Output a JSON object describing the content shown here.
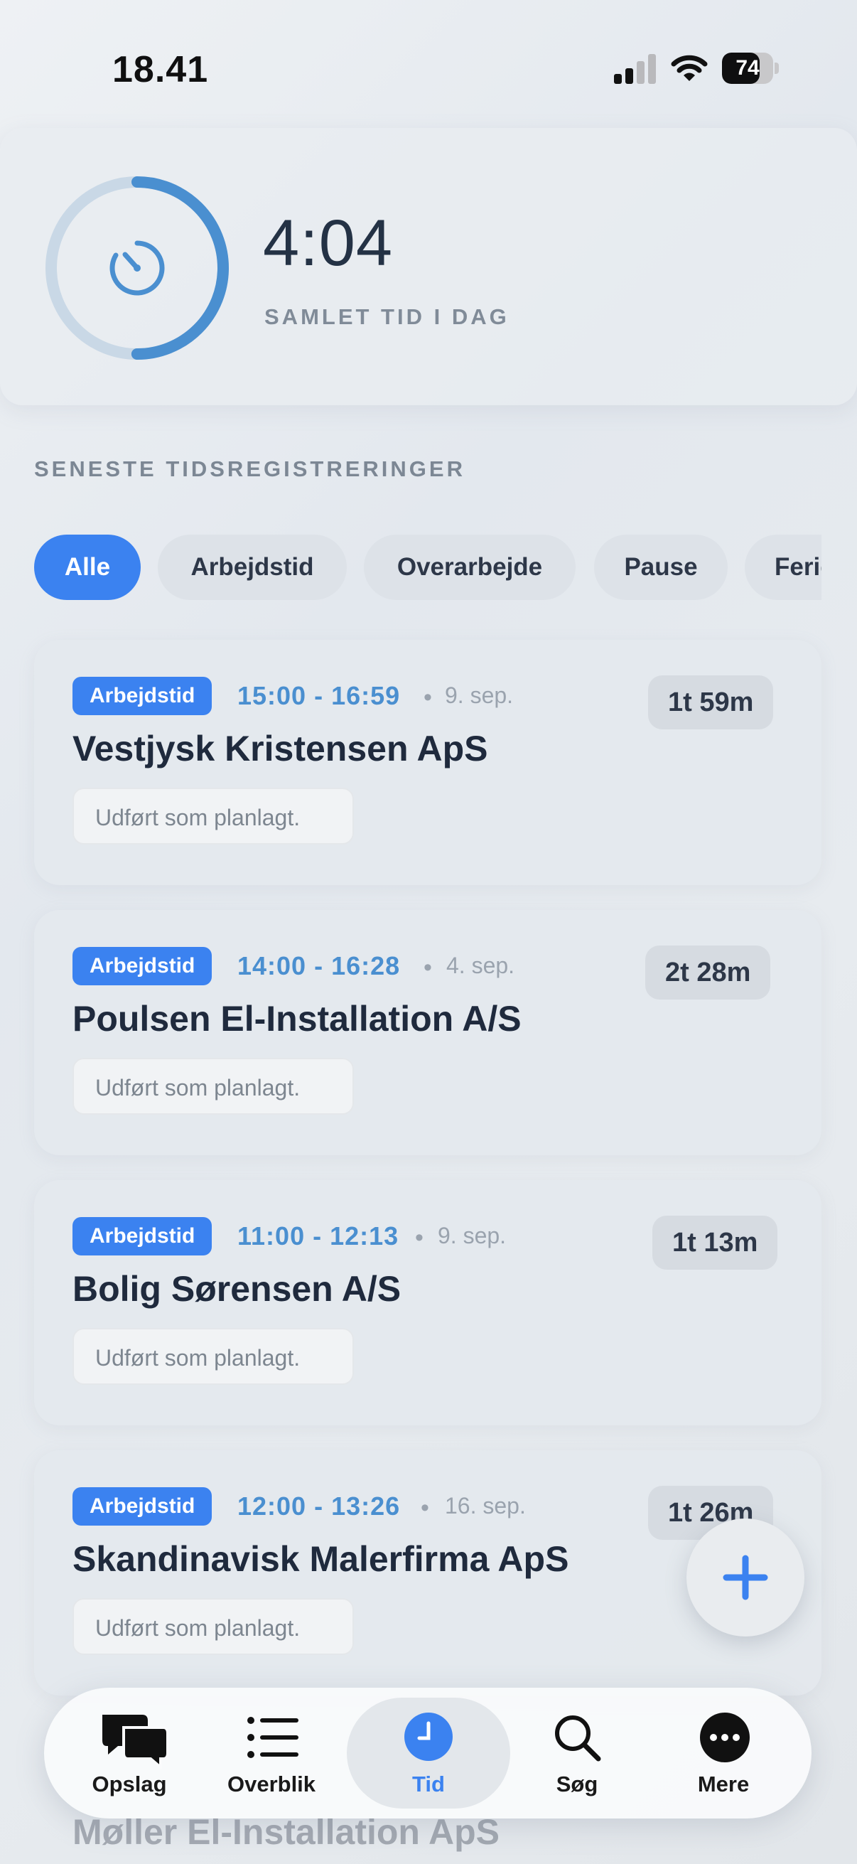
{
  "status_bar": {
    "time": "18.41",
    "battery": "74",
    "battery_level": 0.74
  },
  "summary": {
    "value": "4:04",
    "label": "SAMLET TID I DAG",
    "progress": 0.5
  },
  "section_title": "SENESTE TIDSREGISTRERINGER",
  "filters": [
    {
      "label": "Alle",
      "active": true
    },
    {
      "label": "Arbejdstid",
      "active": false
    },
    {
      "label": "Overarbejde",
      "active": false
    },
    {
      "label": "Pause",
      "active": false
    },
    {
      "label": "Ferie",
      "active": false
    }
  ],
  "entries": [
    {
      "type": "Arbejdstid",
      "time": "15:00 - 16:59",
      "date": "9. sep.",
      "duration": "1t 59m",
      "company": "Vestjysk Kristensen ApS",
      "note": "Udført som planlagt."
    },
    {
      "type": "Arbejdstid",
      "time": "14:00 - 16:28",
      "date": "4. sep.",
      "duration": "2t 28m",
      "company": "Poulsen El-Installation A/S",
      "note": "Udført som planlagt."
    },
    {
      "type": "Arbejdstid",
      "time": "11:00 - 12:13",
      "date": "9. sep.",
      "duration": "1t 13m",
      "company": "Bolig Sørensen A/S",
      "note": "Udført som planlagt."
    },
    {
      "type": "Arbejdstid",
      "time": "12:00 - 13:26",
      "date": "16. sep.",
      "duration": "1t 26m",
      "company": "Skandinavisk Malerfirma ApS",
      "note": "Udført som planlagt."
    }
  ],
  "peek_entry": {
    "company": "Møller El-Installation ApS"
  },
  "tabs": [
    {
      "label": "Opslag",
      "icon": "chat-bubbles-icon"
    },
    {
      "label": "Overblik",
      "icon": "list-icon"
    },
    {
      "label": "Tid",
      "icon": "clock-icon",
      "active": true
    },
    {
      "label": "Søg",
      "icon": "search-icon"
    },
    {
      "label": "Mere",
      "icon": "more-icon"
    }
  ],
  "colors": {
    "accent": "#3b82f0",
    "ring": "#4a8fd0",
    "ring_track": "#c9d8e6",
    "time_text": "#4a8fd0"
  }
}
